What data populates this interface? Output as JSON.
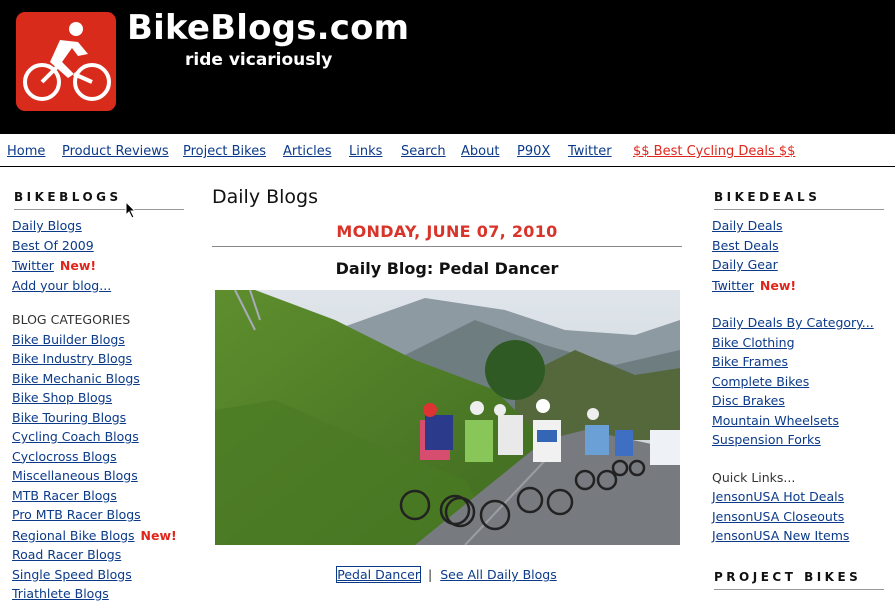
{
  "header": {
    "title": "BikeBlogs.com",
    "tagline": "ride vicariously",
    "logo_icon": "cyclist-icon",
    "colors": {
      "background": "#000000",
      "logo": "#d92b1b"
    }
  },
  "nav": {
    "items": [
      {
        "label": "Home"
      },
      {
        "label": "Product Reviews"
      },
      {
        "label": "Project Bikes"
      },
      {
        "label": "Articles"
      },
      {
        "label": "Links"
      },
      {
        "label": "Search"
      },
      {
        "label": "About"
      },
      {
        "label": "P90X"
      },
      {
        "label": "Twitter"
      },
      {
        "label": "$$ Best Cycling Deals $$"
      }
    ]
  },
  "left": {
    "heading": "BIKEBLOGS",
    "links": [
      {
        "label": "Daily Blogs"
      },
      {
        "label": "Best Of 2009"
      },
      {
        "label": "Twitter"
      },
      {
        "label": "Add your blog..."
      }
    ],
    "new_badge": "New!",
    "categories_heading": "BLOG CATEGORIES",
    "categories": [
      {
        "label": "Bike Builder Blogs"
      },
      {
        "label": "Bike Industry Blogs"
      },
      {
        "label": "Bike Mechanic Blogs"
      },
      {
        "label": "Bike Shop Blogs"
      },
      {
        "label": "Bike Touring Blogs"
      },
      {
        "label": "Cycling Coach Blogs"
      },
      {
        "label": "Cyclocross Blogs"
      },
      {
        "label": "Miscellaneous Blogs"
      },
      {
        "label": "MTB Racer Blogs"
      },
      {
        "label": "Pro MTB Racer Blogs"
      },
      {
        "label": "Regional Bike Blogs"
      },
      {
        "label": "Road Racer Blogs"
      },
      {
        "label": "Single Speed Blogs"
      },
      {
        "label": "Triathlete Blogs"
      }
    ]
  },
  "main": {
    "title": "Daily Blogs",
    "date": "MONDAY, JUNE 07, 2010",
    "post_title": "Daily Blog: Pedal Dancer",
    "photo_link": "Pedal Dancer",
    "separator": "|",
    "see_all": "See All Daily Blogs"
  },
  "right": {
    "heading": "BIKEDEALS",
    "links": [
      {
        "label": "Daily Deals"
      },
      {
        "label": "Best Deals"
      },
      {
        "label": "Daily Gear"
      },
      {
        "label": "Twitter"
      }
    ],
    "new_badge": "New!",
    "category_heading": "Daily Deals By Category...",
    "categories": [
      {
        "label": "Bike Clothing"
      },
      {
        "label": "Bike Frames"
      },
      {
        "label": "Complete Bikes"
      },
      {
        "label": "Disc Brakes"
      },
      {
        "label": "Mountain Wheelsets"
      },
      {
        "label": "Suspension Forks"
      }
    ],
    "quick_heading": "Quick Links...",
    "quick_links": [
      {
        "label": "JensonUSA Hot Deals"
      },
      {
        "label": "JensonUSA Closeouts"
      },
      {
        "label": "JensonUSA New Items"
      }
    ],
    "project_heading": "PROJECT BIKES"
  }
}
